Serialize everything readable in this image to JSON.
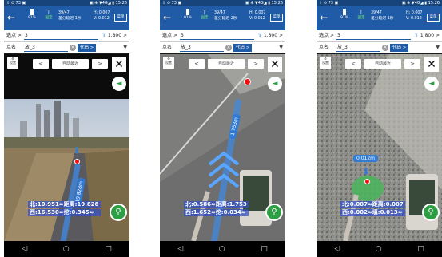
{
  "colors": {
    "primary": "#1f5ba6",
    "status": "#16447b",
    "accent_green": "#2e9e45",
    "target_red": "#e11111",
    "overlay_blue": "#2f7bd6"
  },
  "screens": [
    {
      "status": {
        "left": "⇧ ⊙ 73 ▣",
        "right": "▣ ✻ ▼4G◢ ▮ 15:26"
      },
      "battery": "91%",
      "fix": "固定",
      "rtk": [
        "39/47",
        "差分延迟 1秒"
      ],
      "hv": [
        "H: 0.007",
        "V: 0.012"
      ],
      "menu": "菜单",
      "row1": {
        "label": "选点 >",
        "value": "3",
        "height": "1.800 >"
      },
      "row2": {
        "label": "点名",
        "value": "放_3",
        "code": "代码 >"
      },
      "controls": {
        "settings": "设置",
        "prev": "<",
        "auto": "自动最近",
        "next": ">"
      },
      "distance": "19.828m",
      "readout": [
        "北:10.951≈距离:19.828",
        "西:16.530≈挖:0.345≈"
      ]
    },
    {
      "status": {
        "left": "⇧ ⊙ 73 ▣",
        "right": "▣ ✻ ▼4G◢ ▮ 15:26"
      },
      "battery": "91%",
      "fix": "固定",
      "rtk": [
        "39/47",
        "差分延迟 2秒"
      ],
      "hv": [
        "H: 0.007",
        "V: 0.012"
      ],
      "menu": "菜单",
      "row1": {
        "label": "选点 >",
        "value": "3",
        "height": "1.800 >"
      },
      "row2": {
        "label": "点名",
        "value": "放_3",
        "code": "代码 >"
      },
      "controls": {
        "settings": "设置",
        "prev": "<",
        "auto": "自动最近",
        "next": ">"
      },
      "distance": "1.753m",
      "readout": [
        "北:0.586≈距离:1.753",
        "西:1.652≈挖:0.034≈"
      ]
    },
    {
      "status": {
        "left": "⇧ ⊙ 73 ▣",
        "right": "▣ ✻ ▼4G◢ ▮ 15:26"
      },
      "battery": "91%",
      "fix": "固定",
      "rtk": [
        "39/47",
        "差分延迟 1秒"
      ],
      "hv": [
        "H: 0.007",
        "V: 0.012"
      ],
      "menu": "菜单",
      "row1": {
        "label": "选点 >",
        "value": "3",
        "height": "1.800 >"
      },
      "row2": {
        "label": "点名",
        "value": "放_3",
        "code": "代码 >"
      },
      "controls": {
        "settings": "设置",
        "prev": "<",
        "auto": "自动最近",
        "next": ">"
      },
      "distance": "0.012m",
      "readout": [
        "北:0.007≈距离:0.007",
        "西:0.002≈填:0.013≈"
      ]
    }
  ],
  "system_nav": {
    "back": "◁",
    "home": "○",
    "recent": "□"
  }
}
